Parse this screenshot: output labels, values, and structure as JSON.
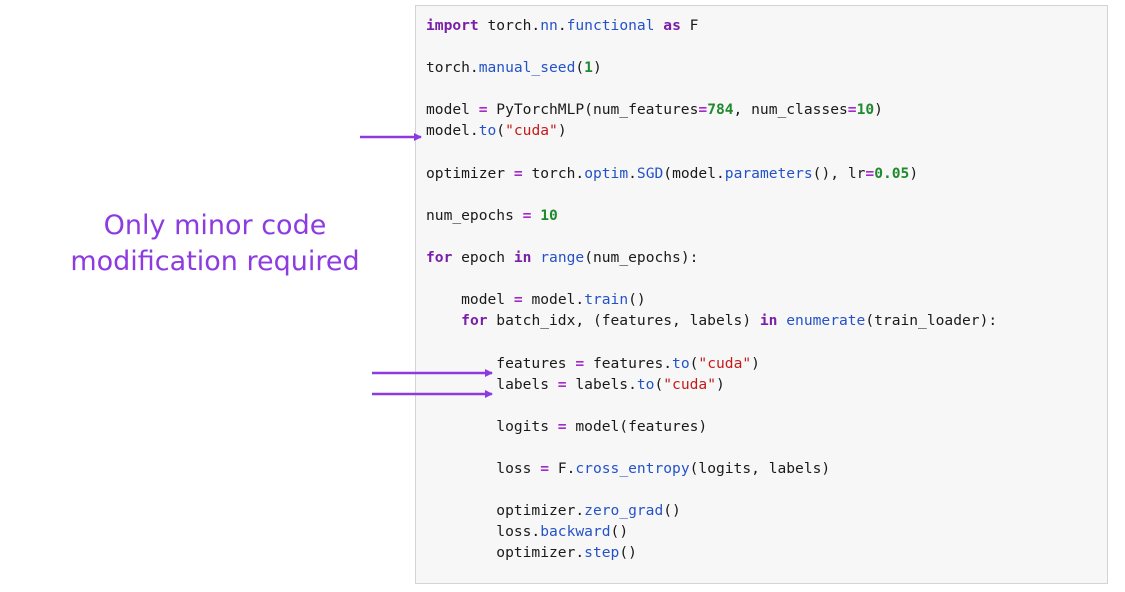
{
  "caption": {
    "line1": "Only minor code",
    "line2": "modification required"
  },
  "code": {
    "lines": [
      [
        {
          "t": "import",
          "c": "kw"
        },
        {
          "t": " torch."
        },
        {
          "t": "nn",
          "c": "fn"
        },
        {
          "t": "."
        },
        {
          "t": "functional",
          "c": "fn"
        },
        {
          "t": " "
        },
        {
          "t": "as",
          "c": "kw"
        },
        {
          "t": " F"
        }
      ],
      [],
      [
        {
          "t": "torch."
        },
        {
          "t": "manual_seed",
          "c": "fn"
        },
        {
          "t": "("
        },
        {
          "t": "1",
          "c": "num"
        },
        {
          "t": ")"
        }
      ],
      [],
      [
        {
          "t": "model "
        },
        {
          "t": "=",
          "c": "op"
        },
        {
          "t": " PyTorchMLP(num_features"
        },
        {
          "t": "=",
          "c": "op"
        },
        {
          "t": "784",
          "c": "num"
        },
        {
          "t": ", num_classes"
        },
        {
          "t": "=",
          "c": "op"
        },
        {
          "t": "10",
          "c": "num"
        },
        {
          "t": ")"
        }
      ],
      [
        {
          "t": "model."
        },
        {
          "t": "to",
          "c": "fn"
        },
        {
          "t": "("
        },
        {
          "t": "\"cuda\"",
          "c": "str"
        },
        {
          "t": ")"
        }
      ],
      [],
      [
        {
          "t": "optimizer "
        },
        {
          "t": "=",
          "c": "op"
        },
        {
          "t": " torch."
        },
        {
          "t": "optim",
          "c": "fn"
        },
        {
          "t": "."
        },
        {
          "t": "SGD",
          "c": "fn"
        },
        {
          "t": "(model."
        },
        {
          "t": "parameters",
          "c": "fn"
        },
        {
          "t": "(), lr"
        },
        {
          "t": "=",
          "c": "op"
        },
        {
          "t": "0.05",
          "c": "num"
        },
        {
          "t": ")"
        }
      ],
      [],
      [
        {
          "t": "num_epochs "
        },
        {
          "t": "=",
          "c": "op"
        },
        {
          "t": " "
        },
        {
          "t": "10",
          "c": "num"
        }
      ],
      [],
      [
        {
          "t": "for",
          "c": "kw"
        },
        {
          "t": " epoch "
        },
        {
          "t": "in",
          "c": "kw"
        },
        {
          "t": " "
        },
        {
          "t": "range",
          "c": "fn"
        },
        {
          "t": "(num_epochs):"
        }
      ],
      [],
      [
        {
          "t": "    model "
        },
        {
          "t": "=",
          "c": "op"
        },
        {
          "t": " model."
        },
        {
          "t": "train",
          "c": "fn"
        },
        {
          "t": "()"
        }
      ],
      [
        {
          "t": "    "
        },
        {
          "t": "for",
          "c": "kw"
        },
        {
          "t": " batch_idx, (features, labels) "
        },
        {
          "t": "in",
          "c": "kw"
        },
        {
          "t": " "
        },
        {
          "t": "enumerate",
          "c": "fn"
        },
        {
          "t": "(train_loader):"
        }
      ],
      [],
      [
        {
          "t": "        features "
        },
        {
          "t": "=",
          "c": "op"
        },
        {
          "t": " features."
        },
        {
          "t": "to",
          "c": "fn"
        },
        {
          "t": "("
        },
        {
          "t": "\"cuda\"",
          "c": "str"
        },
        {
          "t": ")"
        }
      ],
      [
        {
          "t": "        labels "
        },
        {
          "t": "=",
          "c": "op"
        },
        {
          "t": " labels."
        },
        {
          "t": "to",
          "c": "fn"
        },
        {
          "t": "("
        },
        {
          "t": "\"cuda\"",
          "c": "str"
        },
        {
          "t": ")"
        }
      ],
      [],
      [
        {
          "t": "        logits "
        },
        {
          "t": "=",
          "c": "op"
        },
        {
          "t": " model(features)"
        }
      ],
      [],
      [
        {
          "t": "        loss "
        },
        {
          "t": "=",
          "c": "op"
        },
        {
          "t": " F."
        },
        {
          "t": "cross_entropy",
          "c": "fn"
        },
        {
          "t": "(logits, labels)"
        }
      ],
      [],
      [
        {
          "t": "        optimizer."
        },
        {
          "t": "zero_grad",
          "c": "fn"
        },
        {
          "t": "()"
        }
      ],
      [
        {
          "t": "        loss."
        },
        {
          "t": "backward",
          "c": "fn"
        },
        {
          "t": "()"
        }
      ],
      [
        {
          "t": "        optimizer."
        },
        {
          "t": "step",
          "c": "fn"
        },
        {
          "t": "()"
        }
      ]
    ]
  },
  "colors": {
    "accent": "#8d3be0",
    "keyword": "#7a1fa8",
    "function": "#2452c8",
    "number": "#1f8a2e",
    "string": "#c41a1a",
    "panel_background": "#f7f7f7"
  }
}
